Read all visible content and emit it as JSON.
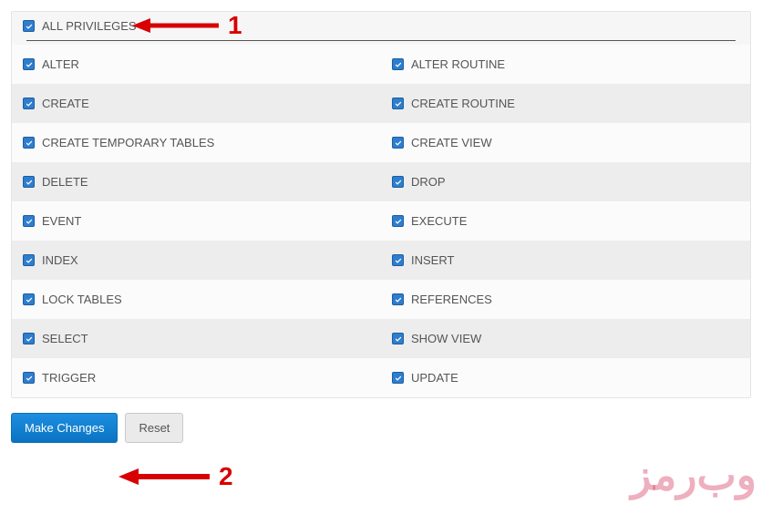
{
  "allPrivilegesLabel": "ALL PRIVILEGES",
  "privileges": [
    {
      "left": "ALTER",
      "right": "ALTER ROUTINE"
    },
    {
      "left": "CREATE",
      "right": "CREATE ROUTINE"
    },
    {
      "left": "CREATE TEMPORARY TABLES",
      "right": "CREATE VIEW"
    },
    {
      "left": "DELETE",
      "right": "DROP"
    },
    {
      "left": "EVENT",
      "right": "EXECUTE"
    },
    {
      "left": "INDEX",
      "right": "INSERT"
    },
    {
      "left": "LOCK TABLES",
      "right": "REFERENCES"
    },
    {
      "left": "SELECT",
      "right": "SHOW VIEW"
    },
    {
      "left": "TRIGGER",
      "right": "UPDATE"
    }
  ],
  "buttons": {
    "makeChanges": "Make Changes",
    "reset": "Reset"
  },
  "annotations": {
    "n1": "1",
    "n2": "2"
  },
  "watermark": "وب‌رمز"
}
